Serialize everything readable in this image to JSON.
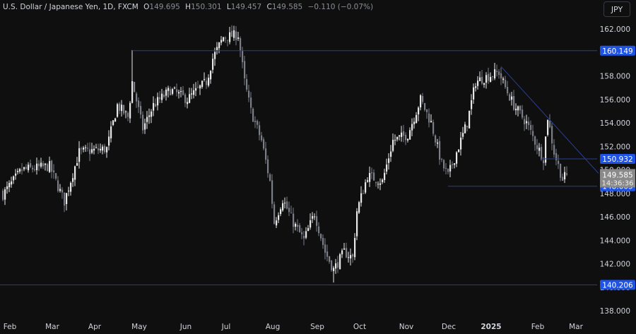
{
  "header": {
    "symbol": "U.S. Dollar / Japanese Yen, 1D, FXCM",
    "o_label": "O",
    "o": "149.695",
    "h_label": "H",
    "h": "150.301",
    "l_label": "L",
    "l": "149.457",
    "c_label": "C",
    "c": "149.585",
    "change": "−0.110 (−0.07%)"
  },
  "currency_button": "JPY",
  "colors": {
    "background": "#0f0f0f",
    "up": "#e8e8e8",
    "down": "#7b7e87",
    "line": "#2a3f8f",
    "label": "#1e53e5",
    "last_price": "#8a8a8a"
  },
  "chart_data": {
    "type": "candlestick",
    "title": "U.S. Dollar / Japanese Yen, 1D, FXCM",
    "ylim": [
      137.5,
      163.5
    ],
    "y_ticks": [
      "162.000",
      "160.000",
      "158.000",
      "156.000",
      "154.000",
      "152.000",
      "150.000",
      "148.000",
      "146.000",
      "144.000",
      "142.000",
      "140.000",
      "138.000"
    ],
    "x_ticks": [
      {
        "label": "Feb",
        "day": 2
      },
      {
        "label": "Mar",
        "day": 22
      },
      {
        "label": "Apr",
        "day": 42
      },
      {
        "label": "May",
        "day": 63
      },
      {
        "label": "Jun",
        "day": 85
      },
      {
        "label": "Jul",
        "day": 104
      },
      {
        "label": "Aug",
        "day": 126
      },
      {
        "label": "Sep",
        "day": 147
      },
      {
        "label": "Oct",
        "day": 167
      },
      {
        "label": "Nov",
        "day": 189
      },
      {
        "label": "Dec",
        "day": 209
      },
      {
        "label": "2025",
        "day": 229,
        "bold": true
      },
      {
        "label": "Feb",
        "day": 251
      },
      {
        "label": "Mar",
        "day": 269
      }
    ],
    "close_keypoints": [
      [
        0,
        147.9
      ],
      [
        9,
        150.0
      ],
      [
        22,
        150.3
      ],
      [
        29,
        147.3
      ],
      [
        36,
        151.5
      ],
      [
        49,
        151.8
      ],
      [
        54,
        155.5
      ],
      [
        59,
        154.5
      ],
      [
        61,
        157.5
      ],
      [
        66,
        153.5
      ],
      [
        71,
        155.5
      ],
      [
        79,
        156.8
      ],
      [
        87,
        156.0
      ],
      [
        96,
        157.5
      ],
      [
        99,
        159.5
      ],
      [
        104,
        161.3
      ],
      [
        111,
        161.5
      ],
      [
        114,
        157.5
      ],
      [
        117,
        155.0
      ],
      [
        122,
        152.5
      ],
      [
        126,
        149.0
      ],
      [
        128,
        145.5
      ],
      [
        132,
        147.5
      ],
      [
        137,
        145.5
      ],
      [
        142,
        144.0
      ],
      [
        147,
        146.3
      ],
      [
        152,
        143.0
      ],
      [
        156,
        141.5
      ],
      [
        161,
        143.0
      ],
      [
        165,
        142.5
      ],
      [
        167,
        146.5
      ],
      [
        172,
        149.5
      ],
      [
        179,
        149.0
      ],
      [
        184,
        152.5
      ],
      [
        191,
        153.0
      ],
      [
        194,
        154.5
      ],
      [
        197,
        156.0
      ],
      [
        202,
        154.0
      ],
      [
        207,
        150.5
      ],
      [
        210,
        149.5
      ],
      [
        214,
        151.5
      ],
      [
        219,
        154.0
      ],
      [
        223,
        157.5
      ],
      [
        229,
        158.0
      ],
      [
        234,
        158.3
      ],
      [
        237,
        157.0
      ],
      [
        241,
        155.5
      ],
      [
        247,
        154.0
      ],
      [
        252,
        152.0
      ],
      [
        255,
        151.0
      ],
      [
        257,
        154.5
      ],
      [
        260,
        151.5
      ],
      [
        264,
        149.2
      ],
      [
        266,
        149.585
      ]
    ],
    "levels": [
      {
        "price": 160.149,
        "label": "160.149",
        "from_day": 61
      },
      {
        "price": 150.932,
        "label": "150.932",
        "from_day": 254
      },
      {
        "price": 148.605,
        "label": "148.605",
        "from_day": 210
      },
      {
        "price": 140.206,
        "label": "140.206",
        "from_day": -2
      }
    ],
    "trendline": {
      "from": [
        235,
        158.8
      ],
      "to": [
        281,
        149.7
      ]
    },
    "last_price": {
      "value": "149.585",
      "countdown": "14:36:36"
    }
  }
}
